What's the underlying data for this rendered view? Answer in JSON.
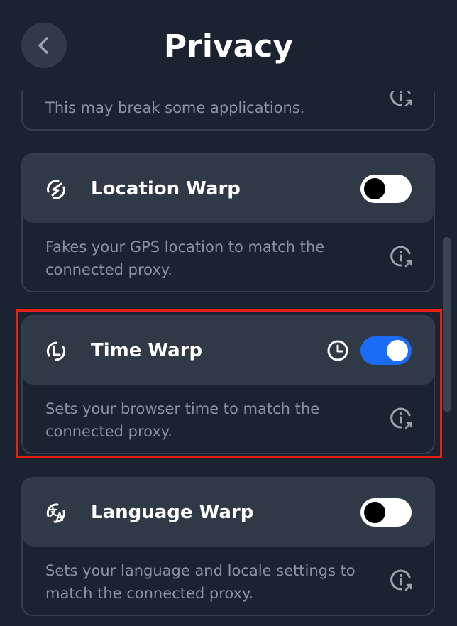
{
  "header": {
    "title": "Privacy"
  },
  "cards": [
    {
      "description": "This may break some applications."
    },
    {
      "title": "Location Warp",
      "enabled": false,
      "description_lines": [
        "Fakes your GPS location to match the",
        "connected proxy."
      ]
    },
    {
      "title": "Time Warp",
      "enabled": true,
      "description_lines": [
        "Sets your browser time to match the",
        "connected proxy."
      ]
    },
    {
      "title": "Language Warp",
      "enabled": false,
      "description_lines": [
        "Sets your language and locale settings to",
        "match the connected proxy."
      ]
    }
  ],
  "colors": {
    "background": "#1b2230",
    "card_header": "#303946",
    "toggle_on": "#1a6cf6",
    "highlight": "#e8210f"
  }
}
